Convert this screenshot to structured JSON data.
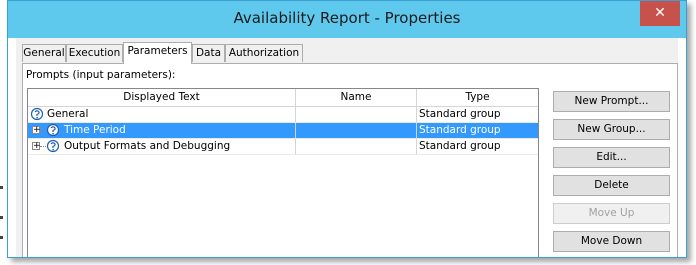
{
  "window": {
    "title": "Availability Report - Properties",
    "close_glyph": "✕"
  },
  "tabs": [
    {
      "label": "General"
    },
    {
      "label": "Execution"
    },
    {
      "label": "Parameters",
      "active": true
    },
    {
      "label": "Data"
    },
    {
      "label": "Authorization"
    }
  ],
  "panel": {
    "prompts_label": "Prompts (input parameters):"
  },
  "table": {
    "columns": [
      "Displayed Text",
      "Name",
      "Type"
    ],
    "rows": [
      {
        "text": "General",
        "name": "",
        "type": "Standard group",
        "expandable": false,
        "selected": false
      },
      {
        "text": "Time Period",
        "name": "",
        "type": "Standard group",
        "expandable": true,
        "selected": true
      },
      {
        "text": "Output Formats and Debugging",
        "name": "",
        "type": "Standard group",
        "expandable": true,
        "selected": false
      }
    ],
    "expand_glyph": "+",
    "icon": "prompt-group-icon"
  },
  "buttons": {
    "new_prompt": "New Prompt...",
    "new_group": "New Group...",
    "edit": "Edit...",
    "delete": "Delete",
    "move_up": "Move Up",
    "move_down": "Move Down"
  },
  "colors": {
    "titlebar": "#5ec8ed",
    "selection": "#3399ff",
    "close": "#c7514b"
  }
}
